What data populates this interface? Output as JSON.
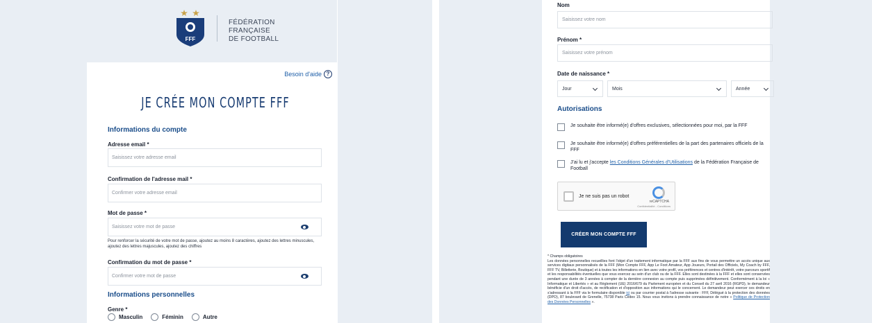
{
  "left": {
    "logo": {
      "letters": "FFF",
      "text_lines": [
        "FÉDÉRATION",
        "FRANÇAISE",
        "DE FOOTBALL"
      ]
    },
    "help_link": "Besoin d'aide",
    "title": "JE CRÉE MON COMPTE FFF",
    "account_section": "Informations du compte",
    "email": {
      "label": "Adresse email *",
      "placeholder": "Saisissez votre adresse email"
    },
    "email_confirm": {
      "label": "Confirmation de l'adresse mail *",
      "placeholder": "Confirmer votre adresse email"
    },
    "password": {
      "label": "Mot de passe *",
      "placeholder": "Saisissez votre mot de passe"
    },
    "password_help": "Pour renforcer la sécurité de votre mot de passe, ajoutez au moins 8 caractères, ajoutez des lettres minuscules, ajoutez des lettres majuscules, ajoutez des chiffres",
    "password_confirm": {
      "label": "Confirmation du mot de passe *",
      "placeholder": "Confirmer votre mot de passe"
    },
    "personal_section": "Informations personnelles",
    "gender": {
      "label": "Genre *",
      "options": [
        "Masculin",
        "Féminin",
        "Autre"
      ]
    }
  },
  "right": {
    "lastname": {
      "label": "Nom",
      "placeholder": "Saisissez votre nom"
    },
    "firstname": {
      "label": "Prénom *",
      "placeholder": "Saisissez votre prénom"
    },
    "birthdate": {
      "label": "Date de naissance *",
      "day": "Jour",
      "month": "Mois",
      "year": "Année"
    },
    "authorizations_section": "Autorisations",
    "consent_1": "Je souhaite être informé(e) d'offres exclusives, sélectionnées pour moi, par la FFF",
    "consent_2": "Je souhaite être informé(e) d'offres préférentielles de la part des partenaires officiels de la FFF",
    "consent_3_prefix": "J'ai lu et j'accepte ",
    "consent_3_link": "les Conditions Générales d'Utilisations",
    "consent_3_suffix": " de la Fédération Française de Football",
    "captcha": {
      "label": "Je ne suis pas un robot",
      "brand": "reCAPTCHA",
      "links": "Confidentialité - Conditions"
    },
    "submit": "CRÉER MON COMPTE FFF",
    "legal_required": "* Champs obligatoires",
    "legal_body": "Les données personnelles recueillies font l'objet d'un traitement informatique par la FFF aux fins de vous permettre un accès unique aux services digitaux personnalisés de la FFF (Mon Compte FFF, App Le Foot Amateur, App Joueurs, Portail des Officiels, My Coach by FFF, FFF TV, Billetterie, Boutique) et à toutes les informations en lien avec votre profil, vos préférences et centres d'intérêt, votre parcours sportif et les responsabilités éventuelles que vous exercez au sein d'un club ou de la FFF. Elles sont destinées à la FFF et elles sont conservées pendant une durée de 3 années à compter de la dernière connexion au compte puis supprimées définitivement. Conformément à la loi « Informatique et Libertés » et au Règlement (UE) 2016/679 du Parlement européen et du Conseil du 27 avril 2016 (RGPD), le demandeur bénéficie d'un droit d'accès, de rectification et d'opposition aux informations qui le concernent. Le demandeur peut exercer ces droits en s'adressant à la FFF via le formulaire disponible ",
    "legal_link_1": "ici",
    "legal_mid": " ou par courrier postal à l'adresse suivante : FFF, Délégué à la protection des données (DPO), 87 boulevard de Grenelle, 75738 Paris Cedex 15. Nous vous invitons à prendre connaissance de notre « ",
    "legal_link_2": "Politique de Protection des Données Personnelles",
    "legal_end": " »."
  },
  "colors": {
    "brand_blue": "#133a6e",
    "link_blue": "#1f5fa8",
    "page_bg": "#e9eef4"
  }
}
